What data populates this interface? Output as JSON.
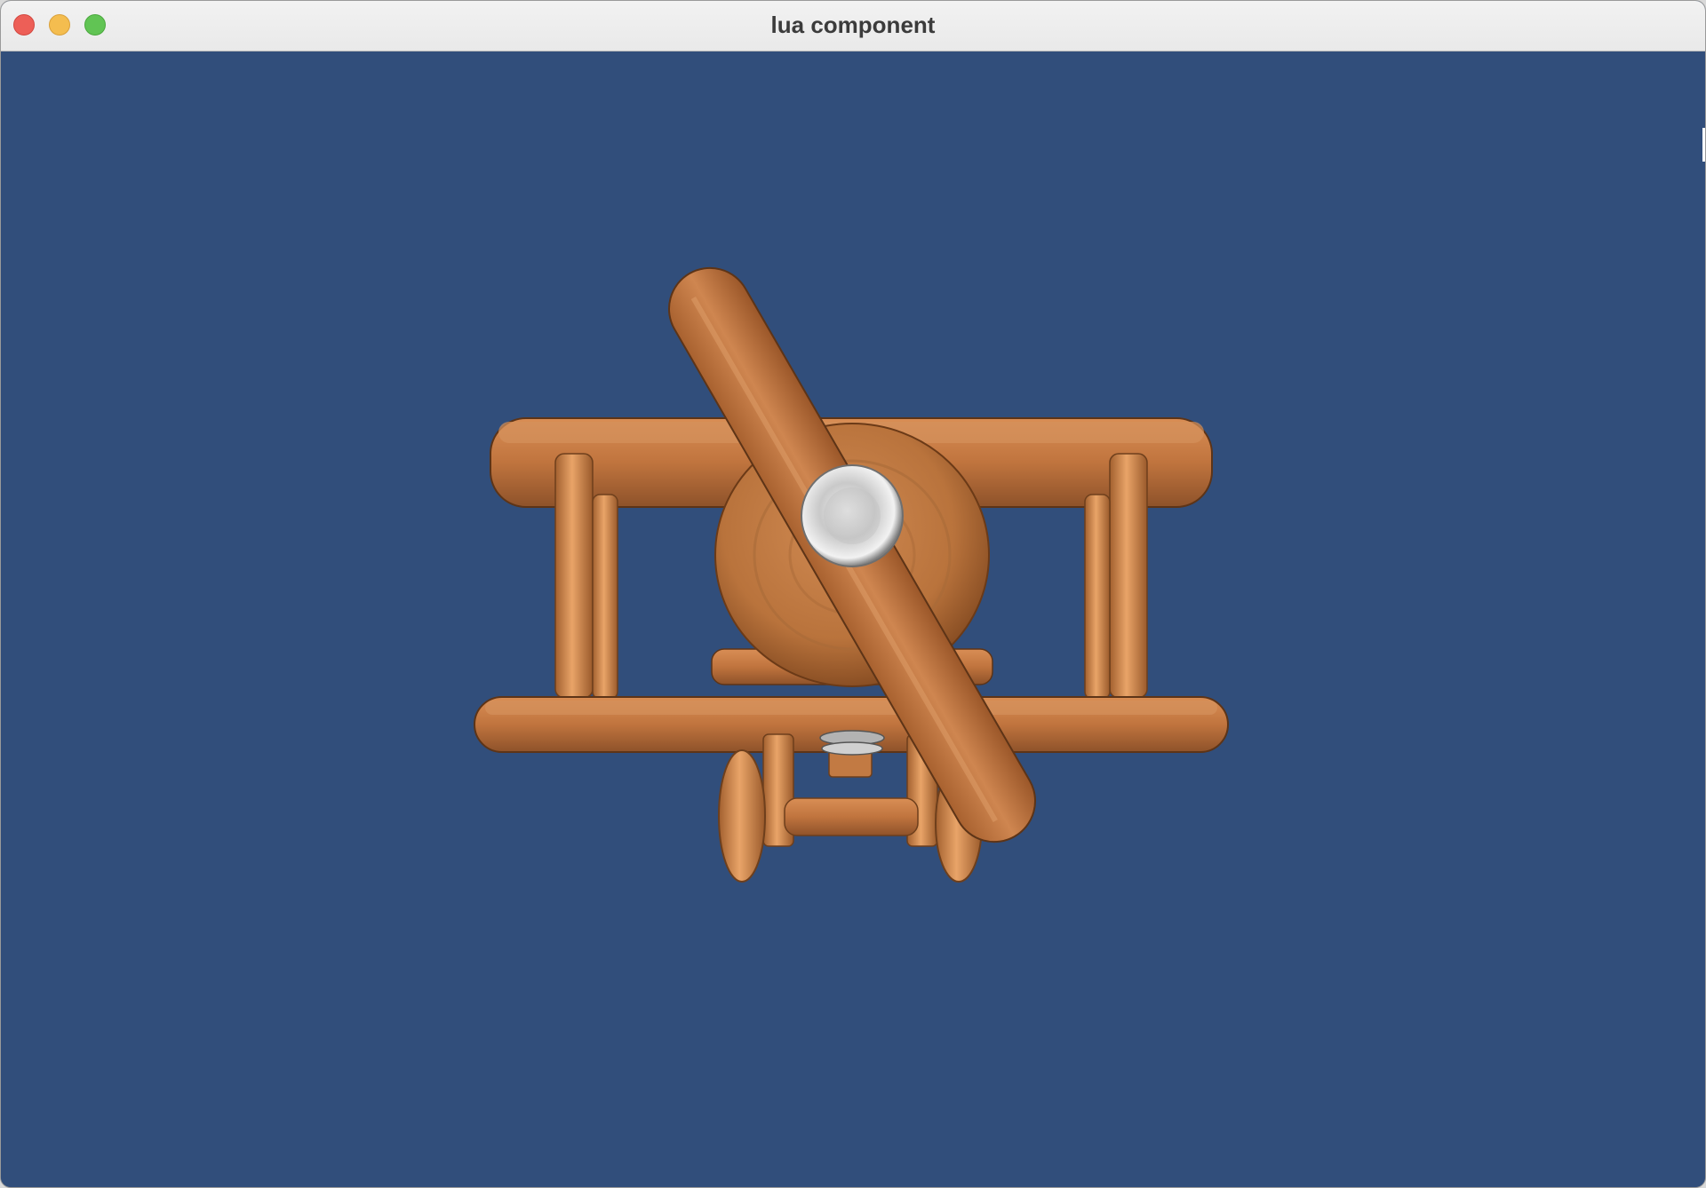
{
  "window": {
    "title": "lua component"
  },
  "viewport": {
    "background_color": "#314e7b",
    "scene": "wooden-biplane-model"
  },
  "colors": {
    "wood": "#c37a43",
    "wood_dark": "#8a4f26",
    "spinner": "#d8d8d8"
  }
}
